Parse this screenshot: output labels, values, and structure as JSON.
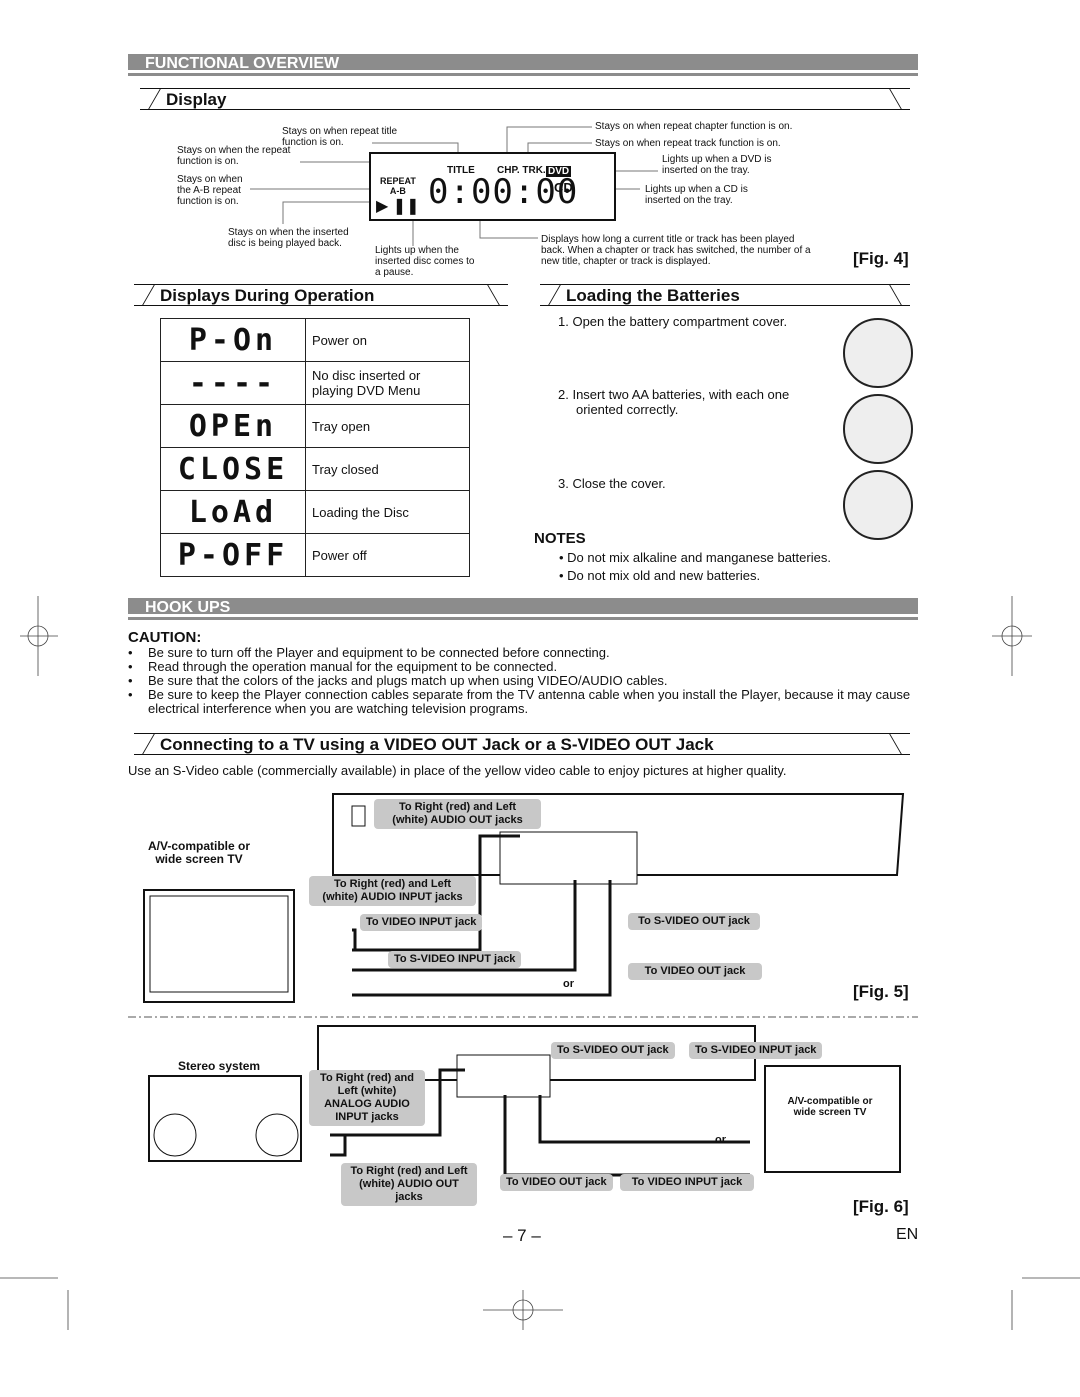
{
  "functional_overview": {
    "title": "FUNCTIONAL OVERVIEW",
    "display": {
      "title": "Display",
      "callouts": {
        "repeat_title": "Stays on when repeat title function is on.",
        "repeat": "Stays on when the repeat function is on.",
        "ab_repeat": "Stays on when the A-B repeat function is on.",
        "play": "Stays on when the inserted disc is being played back.",
        "pause": "Lights up when the inserted disc comes to a pause.",
        "repeat_chapter": "Stays on when repeat chapter function is on.",
        "repeat_track": "Stays on when repeat track function is on.",
        "dvd": "Lights up when a DVD is inserted on the tray.",
        "cd": "Lights up when a CD is inserted on the tray.",
        "time": "Displays how long a current title or track has been played back. When a chapter or track has switched, the number of a new title, chapter or track is displayed."
      },
      "lcd": {
        "repeat": "REPEAT",
        "ab": "A-B",
        "title": "TITLE",
        "chp_trk": "CHP. TRK.",
        "dvd": "DVD",
        "cd": "CD",
        "digits": "0:00:00"
      },
      "fig": "[Fig. 4]"
    },
    "operation": {
      "title": "Displays During Operation",
      "rows": [
        {
          "display": "P-On",
          "label": "Power on"
        },
        {
          "display": "----",
          "label": "No disc inserted or playing DVD Menu"
        },
        {
          "display": "OPEn",
          "label": "Tray open"
        },
        {
          "display": "CLOSE",
          "label": "Tray closed"
        },
        {
          "display": "LoAd",
          "label": "Loading the Disc"
        },
        {
          "display": "P-OFF",
          "label": "Power off"
        }
      ]
    },
    "batteries": {
      "title": "Loading the Batteries",
      "steps": [
        "1. Open the battery compartment cover.",
        "2. Insert two AA batteries, with each one oriented correctly.",
        "3. Close the cover."
      ],
      "notes_title": "NOTES",
      "notes": [
        "Do not mix alkaline and manganese batteries.",
        "Do not mix old and new batteries."
      ]
    }
  },
  "hookups": {
    "title": "HOOK UPS",
    "caution_title": "CAUTION:",
    "caution": [
      "Be sure to turn off the Player and equipment to be connected before connecting.",
      "Read through the operation manual for the equipment to be connected.",
      "Be sure that the colors of the jacks and plugs match up when using VIDEO/AUDIO cables.",
      "Be sure to keep the Player connection cables separate from the TV antenna cable when you install the Player, because it may cause electrical interference when you are watching television programs."
    ],
    "connect_title": "Connecting to a TV using a VIDEO OUT Jack or a S-VIDEO OUT Jack",
    "intro": "Use an S-Video cable (commercially available) in place of the yellow video cable to enjoy pictures at higher quality.",
    "fig5": {
      "tv": "A/V-compatible or wide screen TV",
      "audio_out": "To Right (red) and Left (white) AUDIO OUT jacks",
      "audio_in": "To Right (red) and Left (white) AUDIO INPUT jacks",
      "video_in": "To VIDEO INPUT jack",
      "svideo_in": "To S-VIDEO INPUT jack",
      "svideo_out": "To S-VIDEO OUT jack",
      "video_out": "To VIDEO OUT jack",
      "or": "or",
      "fig": "[Fig. 5]"
    },
    "fig6": {
      "stereo": "Stereo system",
      "analog_in": "To Right (red) and Left (white) ANALOG AUDIO INPUT jacks",
      "audio_out": "To Right (red) and Left (white) AUDIO OUT jacks",
      "svideo_out": "To S-VIDEO OUT jack",
      "svideo_in": "To S-VIDEO INPUT jack",
      "video_out": "To VIDEO OUT jack",
      "video_in": "To VIDEO INPUT jack",
      "tv": "A/V-compatible or wide screen TV",
      "or": "or",
      "fig": "[Fig. 6]"
    }
  },
  "footer": {
    "page": "– 7 –",
    "lang": "EN"
  }
}
